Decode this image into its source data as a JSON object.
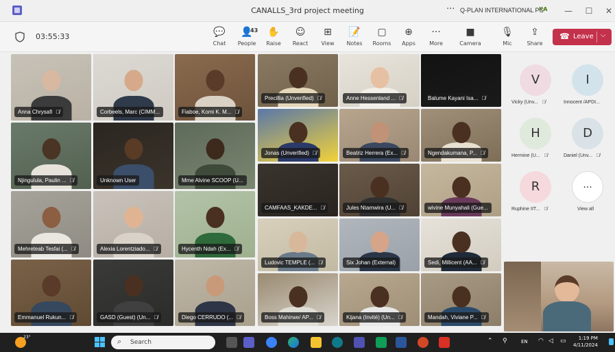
{
  "window": {
    "title": "CANALLS_3rd project meeting",
    "more": "···",
    "org": "Q-PLAN INTERNATIONAL PC",
    "org_initials": "KA",
    "minimize": "—",
    "maximize": "☐",
    "close": "✕"
  },
  "toolbar": {
    "timer": "03:55:33",
    "people_count": "43",
    "tools": [
      {
        "label": "Chat",
        "icon": "chat-icon",
        "glyph": "💬"
      },
      {
        "label": "People",
        "icon": "people-icon",
        "glyph": "👤"
      },
      {
        "label": "Raise",
        "icon": "hand-icon",
        "glyph": "✋"
      },
      {
        "label": "React",
        "icon": "smile-icon",
        "glyph": "☺"
      },
      {
        "label": "View",
        "icon": "grid-icon",
        "glyph": "⊞"
      },
      {
        "label": "Notes",
        "icon": "notes-icon",
        "glyph": "📝"
      },
      {
        "label": "Rooms",
        "icon": "rooms-icon",
        "glyph": "▢"
      },
      {
        "label": "Apps",
        "icon": "apps-icon",
        "glyph": "⊕"
      },
      {
        "label": "More",
        "icon": "more-icon",
        "glyph": "···"
      },
      {
        "label": "Camera",
        "icon": "camera-icon",
        "glyph": "■"
      },
      {
        "label": "Mic",
        "icon": "mic-icon",
        "glyph": "🎙"
      },
      {
        "label": "Share",
        "icon": "share-icon",
        "glyph": "⇪"
      }
    ],
    "leave_label": "Leave"
  },
  "participants": [
    {
      "name": "Anna Chrysafi",
      "muted": true
    },
    {
      "name": "Corbeels, Marc (CIMM...",
      "muted": false
    },
    {
      "name": "Fiaboe, Komi K. M...",
      "muted": true
    },
    {
      "name": "Njingulula, Paulin ...",
      "muted": true
    },
    {
      "name": "Unknown User",
      "muted": false
    },
    {
      "name": "Mme Alvine SCOOP (U...",
      "muted": false
    },
    {
      "name": "Mehreteab Tesfai (...",
      "muted": true
    },
    {
      "name": "Alexia Lorentziado...",
      "muted": true
    },
    {
      "name": "Hycenth Ndah (Ex...",
      "muted": true
    },
    {
      "name": "Emmanuel Rukun...",
      "muted": true
    },
    {
      "name": "GASD (Guest) (Un...",
      "muted": true
    },
    {
      "name": "Diego CERRUDO (...",
      "muted": true
    },
    {
      "name": "Precillia (Unverified)",
      "muted": true
    },
    {
      "name": "Anne Hessenland ...",
      "muted": true
    },
    {
      "name": "Balume Kayani Isa...",
      "muted": true
    },
    {
      "name": "Jonas (Unverified)",
      "muted": true
    },
    {
      "name": "Beatriz Herrera (Ex...",
      "muted": true
    },
    {
      "name": "Ngendakumana, P...",
      "muted": true
    },
    {
      "name": "CAMFAAS_KAKDE...",
      "muted": true
    },
    {
      "name": "Jules Ntamwira (U...",
      "muted": true
    },
    {
      "name": "wivine Munyahali (Gue...",
      "muted": false
    },
    {
      "name": "Ludovic TEMPLE (...",
      "muted": true
    },
    {
      "name": "Six Johan (External)",
      "muted": false
    },
    {
      "name": "Sedi, Millicent (AA...",
      "muted": true
    },
    {
      "name": "Boss Mahirwe/ AP...",
      "muted": true
    },
    {
      "name": "Kijana (Invité) (Un...",
      "muted": true
    },
    {
      "name": "Mandah, Viviane P...",
      "muted": true
    }
  ],
  "roster": [
    {
      "initial": "V",
      "label": "Vicky (Unv...",
      "muted": true,
      "color": "#f0dbe3"
    },
    {
      "initial": "I",
      "label": "Innocent /APDI...",
      "muted": false,
      "color": "#d3e3ec"
    },
    {
      "initial": "H",
      "label": "Hermine (U...",
      "muted": true,
      "color": "#dfe9dc"
    },
    {
      "initial": "D",
      "label": "Daniel (Unv...",
      "muted": true,
      "color": "#d9e2e7"
    },
    {
      "initial": "R",
      "label": "Ruphine IIT...",
      "muted": true,
      "color": "#f5d9dc"
    }
  ],
  "view_all": {
    "glyph": "···",
    "label": "View all"
  },
  "mute_glyph": "🎙̸",
  "taskbar": {
    "temp": "23°",
    "search_placeholder": "Search",
    "lang": "EN",
    "time": "1:19 PM",
    "date": "4/11/2024"
  },
  "colors": {
    "leave": "#c4314b",
    "accent": "#6b6ec9",
    "taskbar": "#202020"
  }
}
